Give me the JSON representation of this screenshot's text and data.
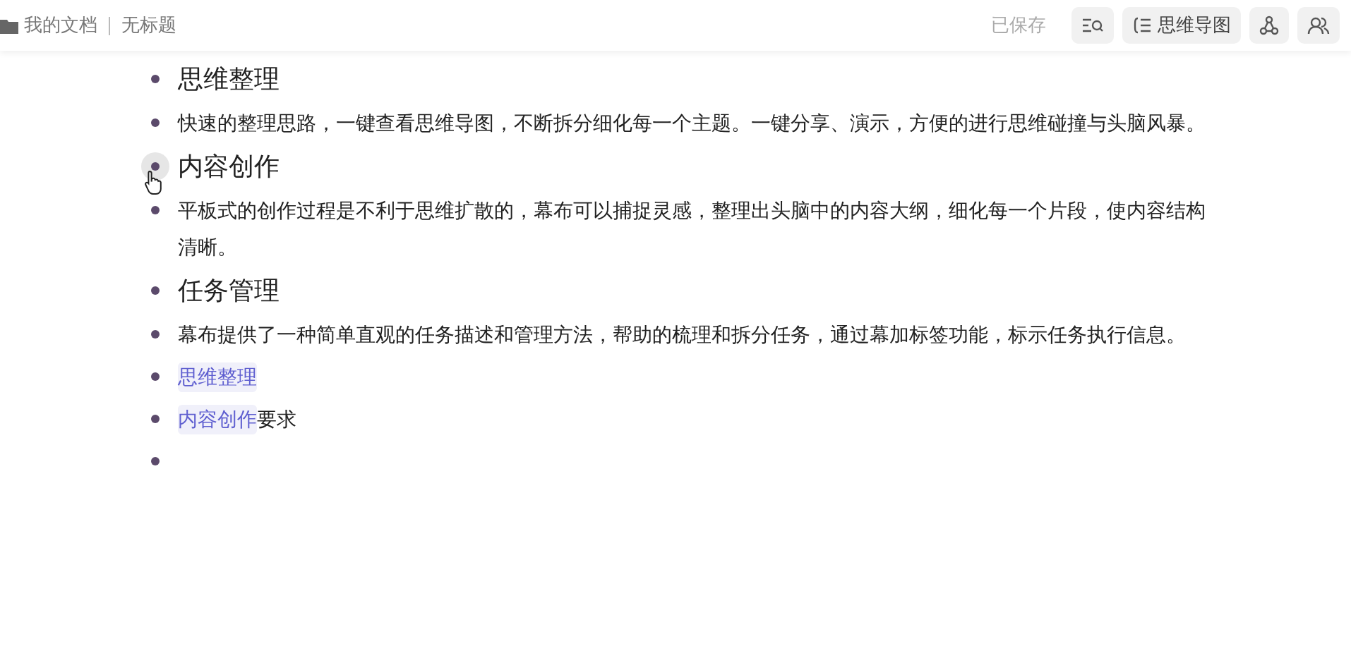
{
  "header": {
    "folder": "我的文档",
    "title": "无标题",
    "status": "已保存",
    "buttons": [
      {
        "kind": "search"
      },
      {
        "kind": "mindmap",
        "label": "思维导图"
      },
      {
        "kind": "share"
      },
      {
        "kind": "users"
      }
    ]
  },
  "items": [
    {
      "kind": "heading",
      "text": "思维整理",
      "hovered": false
    },
    {
      "kind": "paragraph",
      "text": "快速的整理思路，一键查看思维导图，不断拆分细化每一个主题。一键分享、演示，方便的进行思维碰撞与头脑风暴。"
    },
    {
      "kind": "heading",
      "text": "内容创作",
      "hovered": true
    },
    {
      "kind": "paragraph",
      "text": "平板式的创作过程是不利于思维扩散的，幕布可以捕捉灵感，整理出头脑中的内容大纲，细化每一个片段，使内容结构清晰。"
    },
    {
      "kind": "heading",
      "text": "任务管理",
      "hovered": false
    },
    {
      "kind": "paragraph",
      "text": "幕布提供了一种简单直观的任务描述和管理方法，帮助的梳理和拆分任务，通过幕加标签功能，标示任务执行信息。"
    },
    {
      "kind": "link",
      "link": "思维整理"
    },
    {
      "kind": "link",
      "link": "内容创作",
      "suffix": "要求"
    },
    {
      "kind": "empty"
    }
  ]
}
